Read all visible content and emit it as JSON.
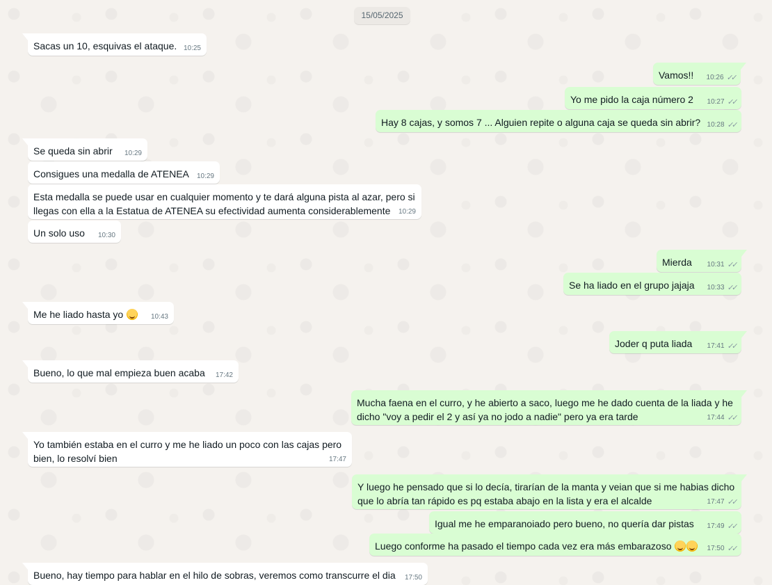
{
  "chat": {
    "date": "15/05/2025",
    "emoji_laugh": "rolling-on-floor-laughing",
    "messages": [
      {
        "text": "Sacas un 10, esquivas el ataque.",
        "time": "10:25"
      },
      {
        "text": "Vamos!!",
        "time": "10:26",
        "ticks": "✓✓"
      },
      {
        "text": "Yo me pido la caja número 2",
        "time": "10:27",
        "ticks": "✓✓"
      },
      {
        "text": "Hay 8 cajas, y somos 7 ... Alguien repite o alguna caja se queda sin abrir?",
        "time": "10:28",
        "ticks": "✓✓"
      },
      {
        "text": "Se queda sin abrir",
        "time": "10:29"
      },
      {
        "text": "Consigues una medalla de ATENEA",
        "time": "10:29"
      },
      {
        "text": "Esta medalla se puede usar en cualquier momento y te dará alguna pista al azar, pero si\nllegas con ella a la Estatua de ATENEA su efectividad aumenta considerablemente",
        "time": "10:29"
      },
      {
        "text": "Un solo uso",
        "time": "10:30"
      },
      {
        "text": "Mierda",
        "time": "10:31",
        "ticks": "✓✓"
      },
      {
        "text": "Se ha liado en el grupo jajaja",
        "time": "10:33",
        "ticks": "✓✓"
      },
      {
        "text": "Me he liado hasta yo",
        "time": "10:43"
      },
      {
        "text": "Joder q puta liada",
        "time": "17:41",
        "ticks": "✓✓"
      },
      {
        "text": "Bueno, lo que mal empieza buen acaba",
        "time": "17:42"
      },
      {
        "text": "Mucha faena en el curro, y he abierto a saco, luego me he dado cuenta de la liada y he\ndicho \"voy a pedir el 2 y así ya no jodo a nadie\" pero ya era tarde",
        "time": "17:44",
        "ticks": "✓✓"
      },
      {
        "text": "Yo también estaba en el curro y me he liado un poco con las cajas pero\nbien, lo resolví bien",
        "time": "17:47"
      },
      {
        "text": "Y luego he pensado que si lo decía, tirarían de la manta y veian que si me habias dicho\nque lo abría tan rápido es pq estaba abajo en la lista y era el alcalde",
        "time": "17:47",
        "ticks": "✓✓"
      },
      {
        "text": "Igual me he emparanoiado pero bueno, no quería dar pistas",
        "time": "17:49",
        "ticks": "✓✓"
      },
      {
        "text": "Luego conforme ha pasado el tiempo cada vez era más embarazoso",
        "time": "17:50",
        "ticks": "✓✓"
      },
      {
        "text": "Bueno, hay tiempo para hablar en el hilo de sobras, veremos como transcurre el dia",
        "time": "17:50"
      }
    ]
  }
}
